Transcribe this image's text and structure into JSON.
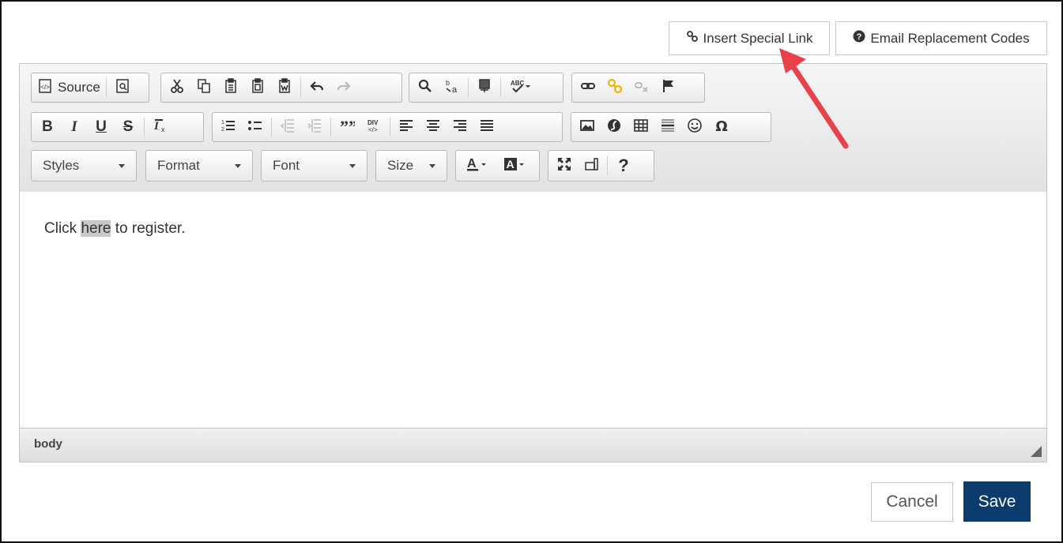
{
  "top_buttons": {
    "insert_special_link": "Insert Special Link",
    "email_replacement_codes": "Email Replacement Codes"
  },
  "toolbar": {
    "source_label": "Source",
    "styles": "Styles",
    "format": "Format",
    "font": "Font",
    "size": "Size",
    "bold": "B",
    "italic": "I",
    "underline": "U",
    "strike": "S",
    "help": "?"
  },
  "content": {
    "before": "Click ",
    "highlight": "here",
    "after": " to register."
  },
  "statusbar": {
    "path": "body"
  },
  "footer": {
    "cancel": "Cancel",
    "save": "Save"
  },
  "colors": {
    "save_bg": "#0c3c6e",
    "arrow": "#e8414a",
    "link_icon_accent": "#f0b400"
  }
}
